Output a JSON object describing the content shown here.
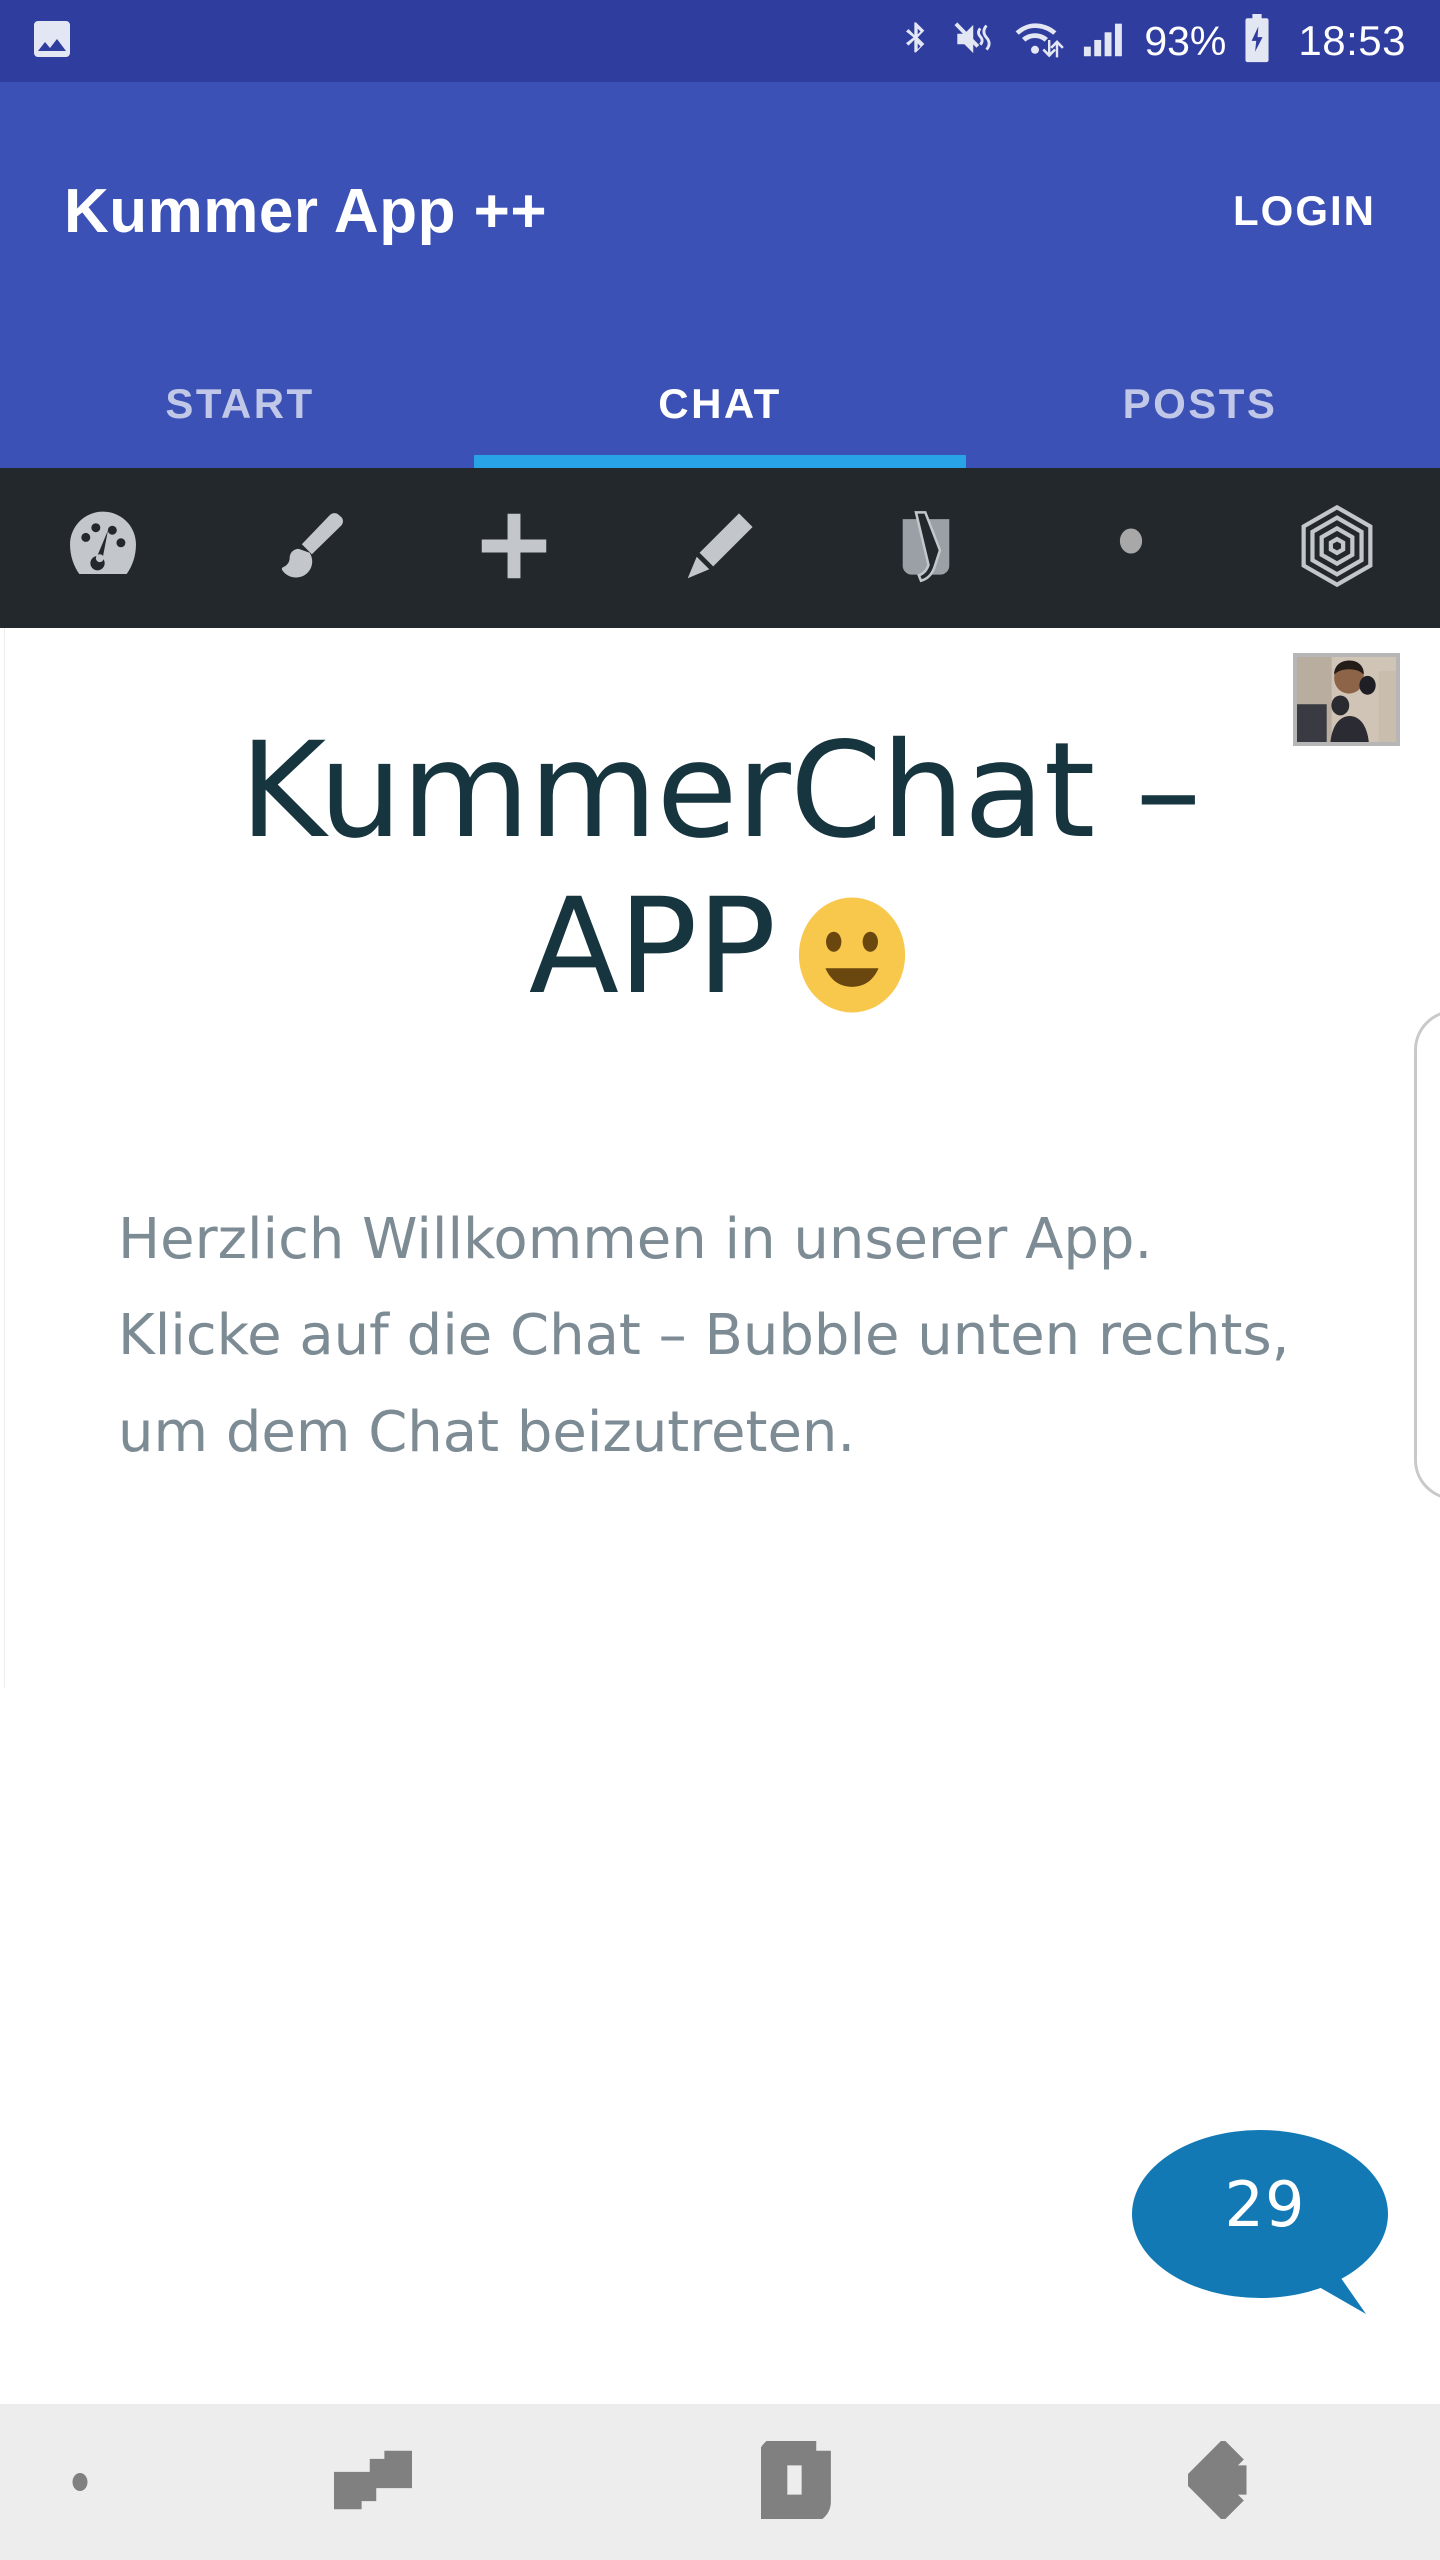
{
  "status_bar": {
    "notification_icon": "image-notification-icon",
    "icons": [
      "bluetooth-icon",
      "vibrate-mute-icon",
      "wifi-icon",
      "signal-bars-icon",
      "battery-charging-icon"
    ],
    "battery_percent": "93%",
    "clock": "18:53",
    "background_color": "#2F3D9E"
  },
  "app_bar": {
    "title": "Kummer App ++",
    "login_label": "LOGIN",
    "background_color": "#3C51B5"
  },
  "tabs": {
    "items": [
      {
        "label": "START",
        "active": false
      },
      {
        "label": "CHAT",
        "active": true
      },
      {
        "label": "POSTS",
        "active": false
      }
    ],
    "indicator_color": "#29A3E8"
  },
  "admin_bar": {
    "background_color": "#23282D",
    "icon_color": "#C3C7CB",
    "items": [
      {
        "name": "wordpress-logo-icon"
      },
      {
        "name": "paintbrush-customize-icon"
      },
      {
        "name": "plus-new-icon"
      },
      {
        "name": "pencil-edit-icon"
      },
      {
        "name": "yoast-seo-icon"
      },
      {
        "name": "avatar-dot-icon"
      },
      {
        "name": "elementor-hexagon-icon"
      }
    ]
  },
  "content": {
    "thumbnail_alt": "profile-photo-thumbnail",
    "headline_line1": "KummerChat –",
    "headline_line2": "APP",
    "headline_emoji": "slightly-smiling-face",
    "headline_color": "#17353F",
    "body_text": "Herzlich Willkommen in unserer App. Klicke auf die Chat – Bubble unten rechts, um dem Chat beizutreten.",
    "body_color": "#7C8B94"
  },
  "chat_fab": {
    "count": "29",
    "color": "#1279B5"
  },
  "nav_bar": {
    "background_color": "#EDEDED",
    "items": [
      {
        "name": "keyboard-indicator-dot-icon"
      },
      {
        "name": "recents-icon"
      },
      {
        "name": "home-icon"
      },
      {
        "name": "back-icon"
      }
    ]
  }
}
